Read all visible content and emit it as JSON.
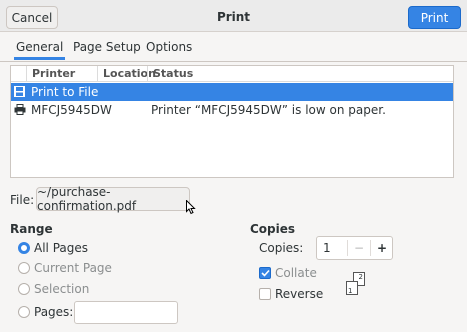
{
  "header": {
    "cancel_label": "Cancel",
    "title": "Print",
    "print_label": "Print"
  },
  "tabs": [
    {
      "label": "General",
      "active": true
    },
    {
      "label": "Page Setup",
      "active": false
    },
    {
      "label": "Options",
      "active": false
    }
  ],
  "printer_list": {
    "columns": [
      "Printer",
      "Location",
      "Status"
    ],
    "rows": [
      {
        "icon": "save-to-file-icon",
        "printer": "Print to File",
        "location": "",
        "status": "",
        "selected": true
      },
      {
        "icon": "printer-icon",
        "printer": "MFCJ5945DW",
        "location": "",
        "status": "Printer “MFCJ5945DW” is low on paper.",
        "selected": false
      }
    ]
  },
  "file": {
    "label": "File:",
    "value": "~/purchase-confirmation.pdf"
  },
  "range": {
    "title": "Range",
    "options": [
      {
        "label": "All Pages",
        "checked": true,
        "enabled": true
      },
      {
        "label": "Current Page",
        "checked": false,
        "enabled": false
      },
      {
        "label": "Selection",
        "checked": false,
        "enabled": false
      },
      {
        "label": "Pages:",
        "checked": false,
        "enabled": true
      }
    ],
    "pages_value": ""
  },
  "copies": {
    "title": "Copies",
    "label": "Copies:",
    "value": "1",
    "minus": "−",
    "plus": "+",
    "collate": {
      "label": "Collate",
      "checked": true
    },
    "reverse": {
      "label": "Reverse",
      "checked": false
    },
    "collate_pages": [
      "1",
      "2"
    ]
  },
  "colors": {
    "accent": "#3584e4"
  }
}
